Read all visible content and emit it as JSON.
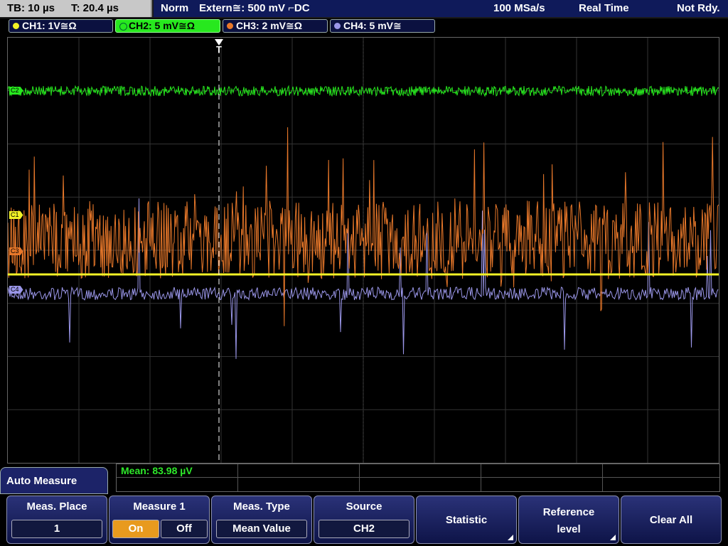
{
  "top": {
    "tb": "TB: 10 µs",
    "t": "T: 20.4 µs",
    "mode": "Norm",
    "trigger": "Extern≅: 500 mV ⌐DC",
    "rate": "100 MSa/s",
    "acq": "Real Time",
    "state": "Not Rdy."
  },
  "channels": [
    {
      "label": "CH1: 1V≅Ω",
      "color": "#f2f226"
    },
    {
      "label": "CH2: 5 mV≅Ω",
      "color": "#27e81e"
    },
    {
      "label": "CH3: 2 mV≅Ω",
      "color": "#e8782a"
    },
    {
      "label": "CH4: 5 mV≅",
      "color": "#9a96e8"
    }
  ],
  "markers": {
    "c1": "C1",
    "c2": "C2",
    "c3": "C3",
    "c4": "C4",
    "trig": "T"
  },
  "measure": {
    "mean": "Mean: 83.98 µV"
  },
  "menu": {
    "title": "Auto Measure",
    "place_label": "Meas. Place",
    "place_value": "1",
    "measure_label": "Measure 1",
    "on": "On",
    "off": "Off",
    "type_label": "Meas. Type",
    "type_value": "Mean Value",
    "source_label": "Source",
    "source_value": "CH2",
    "statistic": "Statistic",
    "reference_1": "Reference",
    "reference_2": "level",
    "clear": "Clear All"
  }
}
